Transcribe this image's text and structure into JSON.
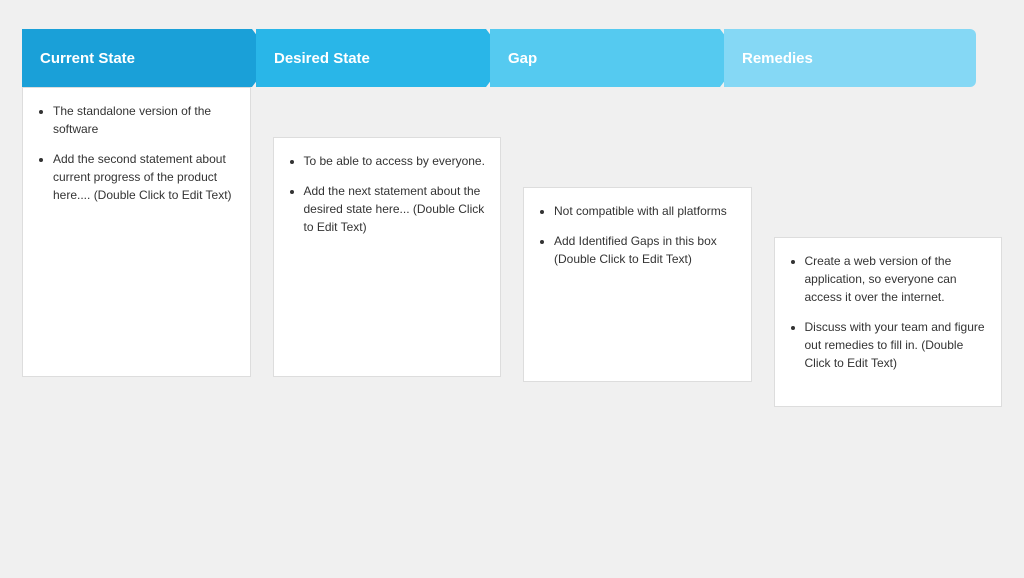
{
  "arrows": [
    {
      "id": "arrow-1",
      "title": "Current State",
      "color": "#1aa0d8",
      "items": [
        "The standalone version of the software",
        "Add the second statement about current progress of the product here.... (Double Click to Edit Text)"
      ]
    },
    {
      "id": "arrow-2",
      "title": "Desired State",
      "color": "#29b6e8",
      "items": [
        "To be able to access by everyone.",
        "Add the next statement about the desired state here...    (Double Click to Edit Text)"
      ]
    },
    {
      "id": "arrow-3",
      "title": "Gap",
      "color": "#55caf0",
      "items": [
        "Not compatible with all platforms",
        "Add Identified Gaps in this box (Double Click to Edit Text)"
      ]
    },
    {
      "id": "arrow-4",
      "title": "Remedies",
      "color": "#85d8f5",
      "items": [
        "Create a web version of the application, so everyone  can access it over the internet.",
        "Discuss with your team and figure out  remedies to fill in. (Double Click to Edit Text)"
      ]
    }
  ]
}
